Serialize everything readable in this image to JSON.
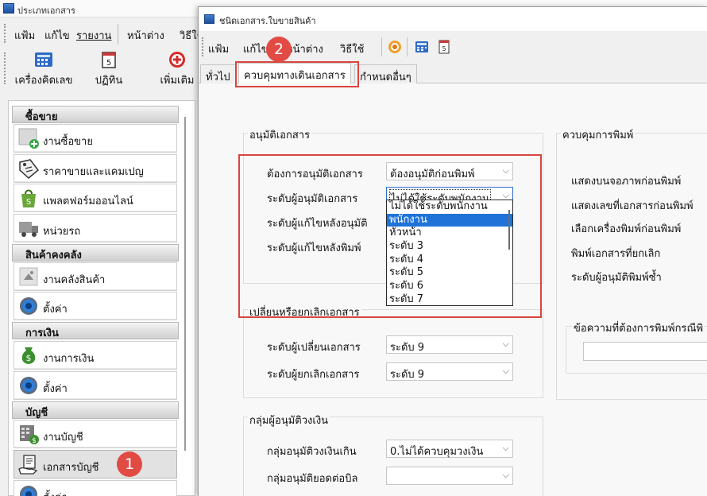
{
  "main_window": {
    "title": "ประเภทเอกสาร",
    "menu": [
      "แฟ้ม",
      "แก้ไข",
      "รายงาน",
      "หน้าต่าง",
      "วิธีใช้"
    ],
    "toolbar": [
      {
        "label": "เครื่องคิดเลข",
        "icon": "calculator-icon"
      },
      {
        "label": "ปฏิทิน",
        "icon": "calendar-icon"
      },
      {
        "label": "เพิ่มเติม",
        "icon": "add-icon"
      }
    ]
  },
  "nav": {
    "groups": [
      {
        "header": "ซื้อขาย",
        "items": [
          {
            "label": "งานซื้อขาย",
            "icon": "sales-icon"
          },
          {
            "label": "ราคาขายและแคมเปญ",
            "icon": "price-tag-icon"
          },
          {
            "label": "แพลตฟอร์มออนไลน์",
            "icon": "shopping-bag-icon"
          },
          {
            "label": "หน่วยรถ",
            "icon": "truck-icon"
          }
        ]
      },
      {
        "header": "สินค้าคงคลัง",
        "items": [
          {
            "label": "งานคลังสินค้า",
            "icon": "warehouse-icon"
          },
          {
            "label": "ตั้งค่า",
            "icon": "settings-icon"
          }
        ]
      },
      {
        "header": "การเงิน",
        "items": [
          {
            "label": "งานการเงิน",
            "icon": "money-bag-icon"
          },
          {
            "label": "ตั้งค่า",
            "icon": "settings-icon"
          }
        ]
      },
      {
        "header": "บัญชี",
        "items": [
          {
            "label": "งานบัญชี",
            "icon": "ledger-icon"
          },
          {
            "label": "เอกสารบัญชี",
            "icon": "document-hand-icon",
            "active": true
          },
          {
            "label": "ตั้งค่า",
            "icon": "settings-icon"
          }
        ]
      }
    ]
  },
  "doc_window": {
    "title": "ชนิดเอกสาร.ใบขายสินค้า",
    "menu": [
      "แฟ้ม",
      "แก้ไข",
      "หน้าต่าง",
      "วิธีใช้"
    ],
    "tabs": [
      {
        "label": "ทั่วไป"
      },
      {
        "label": "ควบคุมทางเดินเอกสาร",
        "active": true
      },
      {
        "label": "กำหนดอื่นๆ"
      }
    ]
  },
  "approve": {
    "title": "อนุมัติเอกสาร",
    "need_label": "ต้องการอนุมัติเอกสาร",
    "need_value": "ต้องอนุมัติก่อนพิมพ์",
    "level_label": "ระดับผู้อนุมัติเอกสาร",
    "level_value": "ไม่ได้ใช้ระดับพนักงาน",
    "edit_after_approve_label": "ระดับผู้แก้ไขหลังอนุมัติ",
    "edit_after_print_label": "ระดับผู้แก้ไขหลังพิมพ์",
    "options": [
      "ไม่ได้ใช้ระดับพนักงาน",
      "พนักงาน",
      "หัวหน้า",
      "ระดับ 3",
      "ระดับ 4",
      "ระดับ 5",
      "ระดับ 6",
      "ระดับ 7"
    ],
    "selected_index": 1
  },
  "change_cancel": {
    "title": "เปลี่ยนหรือยกเลิกเอกสาร",
    "change_label": "ระดับผู้เปลี่ยนเอกสาร",
    "change_value": "ระดับ 9",
    "cancel_label": "ระดับผู้ยกเลิกเอกสาร",
    "cancel_value": "ระดับ 9"
  },
  "credit": {
    "title": "กลุ่มผู้อนุมัติวงเงิน",
    "over_label": "กลุ่มอนุมัติวงเงินเกิน",
    "over_value": "0.ไม่ได้ควบคุมวงเงิน",
    "per_bill_label": "กลุ่มอนุมัติยอดต่อบิล",
    "per_bill_value": ""
  },
  "print_control": {
    "title": "ควบคุมการพิมพ์",
    "rows": [
      "แสดงบนจอภาพก่อนพิมพ์",
      "แสดงเลขที่เอกสารก่อนพิมพ์",
      "เลือกเครื่องพิมพ์ก่อนพิมพ์",
      "พิมพ์เอกสารที่ยกเลิก",
      "ระดับผู้อนุมัติพิมพ์ซ้ำ"
    ],
    "message_label": "ข้อความที่ต้องการพิมพ์กรณีพิ"
  },
  "badges": [
    "1",
    "2"
  ],
  "colors": {
    "highlight": "#d9463f",
    "selection": "#1f73d8"
  }
}
